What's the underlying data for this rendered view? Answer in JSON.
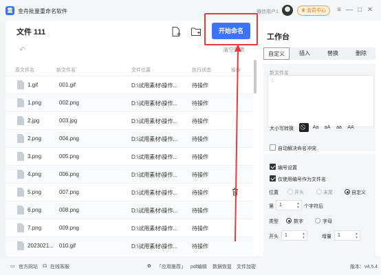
{
  "app": {
    "title": "金舟批量重命名软件",
    "user": "微信用户1",
    "vip_label": "会员中心"
  },
  "window": {
    "menu": "≡",
    "minimize": "—",
    "maximize": "□",
    "close": "✕"
  },
  "toolbar": {
    "file_count_title": "文件 111",
    "start_label": "开始命名",
    "clear_label": "清空列表",
    "undo": "↶"
  },
  "table": {
    "headers": {
      "orig": "原文件名",
      "new": "新文件名",
      "path": "文件位置",
      "status": "执行状态",
      "op": "操作"
    },
    "rows": [
      {
        "orig": "1.gif",
        "new": "001.gif",
        "path": "D:\\试用素材\\操作...",
        "status": "待操作"
      },
      {
        "orig": "1.png",
        "new": "002.png",
        "path": "D:\\试用素材\\操作...",
        "status": "待操作"
      },
      {
        "orig": "2.jpg",
        "new": "003.jpg",
        "path": "D:\\试用素材\\操作...",
        "status": "待操作"
      },
      {
        "orig": "2.png",
        "new": "004.png",
        "path": "D:\\试用素材\\操作...",
        "status": "待操作"
      },
      {
        "orig": "3.png",
        "new": "005.png",
        "path": "D:\\试用素材\\操作...",
        "status": "待操作"
      },
      {
        "orig": "4.png",
        "new": "006.png",
        "path": "D:\\试用素材\\操作...",
        "status": "待操作"
      },
      {
        "orig": "5.png",
        "new": "007.png",
        "path": "D:\\试用素材\\操作...",
        "status": "待操作"
      },
      {
        "orig": "6.png",
        "new": "008.png",
        "path": "D:\\试用素材\\操作...",
        "status": "待操作"
      },
      {
        "orig": "7.png",
        "new": "009.png",
        "path": "D:\\试用素材\\操作...",
        "status": "待操作"
      },
      {
        "orig": "2023021...",
        "new": "010.gif",
        "path": "D:\\试用素材\\操作...",
        "status": "待操作"
      }
    ]
  },
  "workbench": {
    "title": "工作台",
    "tabs": [
      "自定义",
      "插入",
      "替换",
      "删除"
    ],
    "new_name_label": "新文件名",
    "new_name_placeholder": "1",
    "case_label": "大小写转换",
    "case_options": [
      "⃠",
      "Aa",
      "aA",
      "aa",
      "AA"
    ],
    "auto_conflict": "自动解决命名冲突",
    "numbering": "编号设置",
    "use_number_only": "仅使用编号作为文件名",
    "position_label": "位置",
    "position_options": [
      "开头",
      "末尾",
      "自定义"
    ],
    "nth_label": "第",
    "nth_value": "1",
    "nth_suffix": "个字符后",
    "type_label": "类型",
    "type_options": [
      "数字",
      "字母"
    ],
    "start_label": "开头",
    "start_value": "1",
    "increment_label": "增量",
    "increment_value": "1"
  },
  "statusbar": {
    "website": "官方网站",
    "service": "在线客服",
    "recommend": "「应用推荐」",
    "pdf": "pdf编辑",
    "recover": "数据恢复",
    "encrypt": "文件加密",
    "version": "版本：v4.5.4"
  },
  "colors": {
    "accent": "#3d74f5",
    "highlight": "#e8383d"
  }
}
